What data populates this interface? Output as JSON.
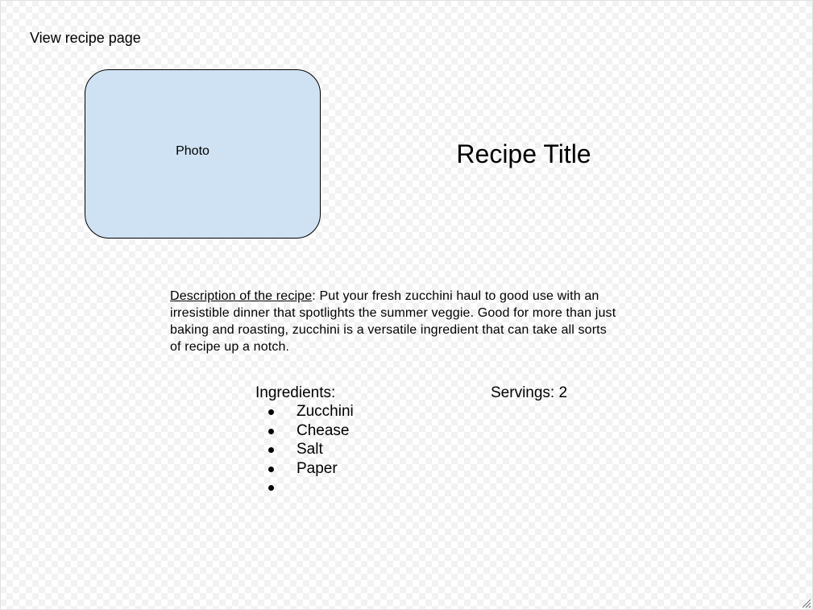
{
  "page": {
    "label": "View recipe page"
  },
  "photo": {
    "label": "Photo",
    "fill_color": "#cfe2f3"
  },
  "recipe": {
    "title": "Recipe Title",
    "description_label": "Description of the recipe",
    "description_text": ": Put your fresh zucchini haul to good use with an irresistible dinner that spotlights the summer veggie. Good for more than just baking and roasting, zucchini is a versatile ingredient that can take all sorts of recipe up a notch."
  },
  "ingredients": {
    "heading": "Ingredients:",
    "items": [
      "Zucchini",
      "Chease",
      "Salt",
      "Paper",
      ""
    ]
  },
  "servings": {
    "text": "Servings: 2"
  },
  "icons": {
    "resize_grip": "resize-grip-icon"
  }
}
